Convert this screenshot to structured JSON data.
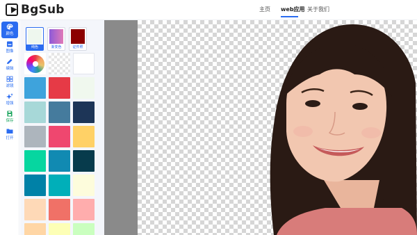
{
  "brand": {
    "name": "BgSub"
  },
  "nav": {
    "home": "主页",
    "web_app": "web应用",
    "about": "关于我们"
  },
  "tools": [
    {
      "label": "颜色",
      "icon": "palette-icon"
    },
    {
      "label": "图像",
      "icon": "image-icon"
    },
    {
      "label": "编辑",
      "icon": "pencil-icon"
    },
    {
      "label": "滤镜",
      "icon": "filter-icon"
    },
    {
      "label": "增强",
      "icon": "sparkle-icon"
    },
    {
      "label": "保存",
      "icon": "save-icon"
    },
    {
      "label": "打开",
      "icon": "folder-icon"
    }
  ],
  "background_types": [
    {
      "label": "纯色",
      "color": "#eef7ee",
      "selected": true
    },
    {
      "label": "渐变色",
      "color": "#c070c8"
    },
    {
      "label": "证件照",
      "color": "#8b0000"
    }
  ],
  "swatches": [
    "color-wheel",
    "transparent",
    "#ffffff",
    "#3ea3dc",
    "#e63a46",
    "#f0f8ee",
    "#a7d8d8",
    "#457b9d",
    "#1d3557",
    "#adb5bd",
    "#ef476f",
    "#ffd166",
    "#06d6a0",
    "#118ab2",
    "#073b4c",
    "#0081a7",
    "#00afb9",
    "#fdfcdc",
    "#fed9b7",
    "#f07167",
    "#ffadad",
    "#ffd6a5",
    "#fdffb6",
    "#caffbf"
  ],
  "colors": {
    "accent": "#2b6cf0",
    "canvas_gray": "#8a8a8a"
  }
}
